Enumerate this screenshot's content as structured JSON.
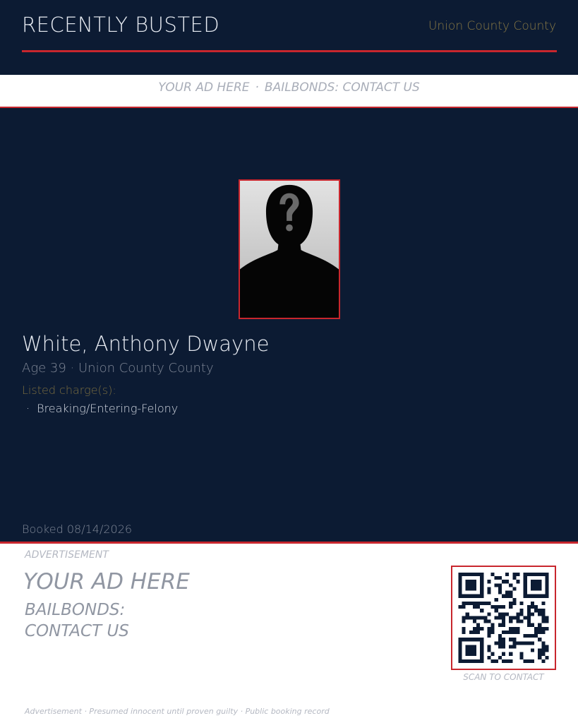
{
  "header": {
    "brand": "RECENTLY BUSTED",
    "county": "Union County County"
  },
  "ad_strip": {
    "left": "YOUR AD HERE",
    "separator": "·",
    "right": "BAILBONDS: CONTACT US"
  },
  "record": {
    "name": "White, Anthony Dwayne",
    "meta": "Age 39 · Union County County",
    "charges_label": "Listed charge(s):",
    "charges": [
      "Breaking/Entering-Felony"
    ],
    "booked": "Booked 08/14/2026"
  },
  "advert": {
    "tag": "ADVERTISEMENT",
    "headline": "YOUR AD HERE",
    "line1": "BAILBONDS:",
    "line2": "CONTACT US",
    "qr_caption": "SCAN TO CONTACT"
  },
  "footer": {
    "disclaimer": "Advertisement · Presumed innocent until proven guilty · Public booking record"
  },
  "colors": {
    "navy": "#0c1b33",
    "accent_red": "#c8262d",
    "gold": "#8a7a45"
  },
  "icons": {
    "mugshot": "silhouette-question-mark",
    "qr": "qr-code"
  }
}
